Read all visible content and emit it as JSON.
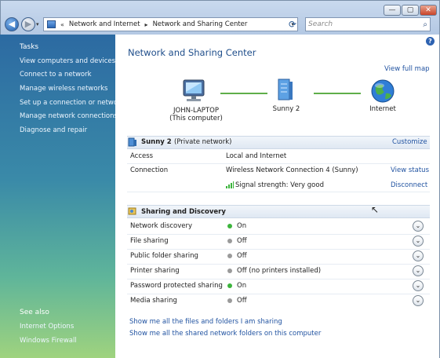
{
  "window": {
    "min": "—",
    "max": "▢",
    "close": "✕"
  },
  "nav": {
    "back": "◀",
    "forward": "▶",
    "dropdown": "▾"
  },
  "address": {
    "prefix": "«",
    "crumbs": [
      "Network and Internet",
      "Network and Sharing Center"
    ],
    "sep": "▸",
    "dropdown": "▾",
    "refresh": "⟳"
  },
  "search": {
    "placeholder": "Search",
    "icon": "⌕"
  },
  "help": "?",
  "sidebar": {
    "tasks_title": "Tasks",
    "tasks": [
      "View computers and devices",
      "Connect to a network",
      "Manage wireless networks",
      "Set up a connection or network",
      "Manage network connections",
      "Diagnose and repair"
    ],
    "see_also_title": "See also",
    "see_also": [
      "Internet Options",
      "Windows Firewall"
    ]
  },
  "main": {
    "title": "Network and Sharing Center",
    "view_full_map": "View full map",
    "map": {
      "computer_name": "JOHN-LAPTOP",
      "computer_sub": "(This computer)",
      "network_name": "Sunny  2",
      "internet": "Internet"
    },
    "network": {
      "name": "Sunny  2",
      "type": "(Private network)",
      "customize": "Customize",
      "access_label": "Access",
      "access_value": "Local and Internet",
      "connection_label": "Connection",
      "connection_value": "Wireless Network Connection 4 (Sunny)",
      "view_status": "View status",
      "signal": "Signal strength:  Very good",
      "disconnect": "Disconnect"
    },
    "sharing": {
      "title": "Sharing and Discovery",
      "items": [
        {
          "label": "Network discovery",
          "value": "On",
          "status_color": "#3cb43c"
        },
        {
          "label": "File sharing",
          "value": "Off",
          "status_color": "#9a9a9a"
        },
        {
          "label": "Public folder sharing",
          "value": "Off",
          "status_color": "#9a9a9a"
        },
        {
          "label": "Printer sharing",
          "value": "Off (no printers installed)",
          "status_color": "#9a9a9a"
        },
        {
          "label": "Password protected sharing",
          "value": "On",
          "status_color": "#3cb43c"
        },
        {
          "label": "Media sharing",
          "value": "Off",
          "status_color": "#9a9a9a"
        }
      ],
      "expand_glyph": "⌄"
    },
    "bottom_links": [
      "Show me all the files and folders I am sharing",
      "Show me all the shared network folders on this computer"
    ]
  }
}
